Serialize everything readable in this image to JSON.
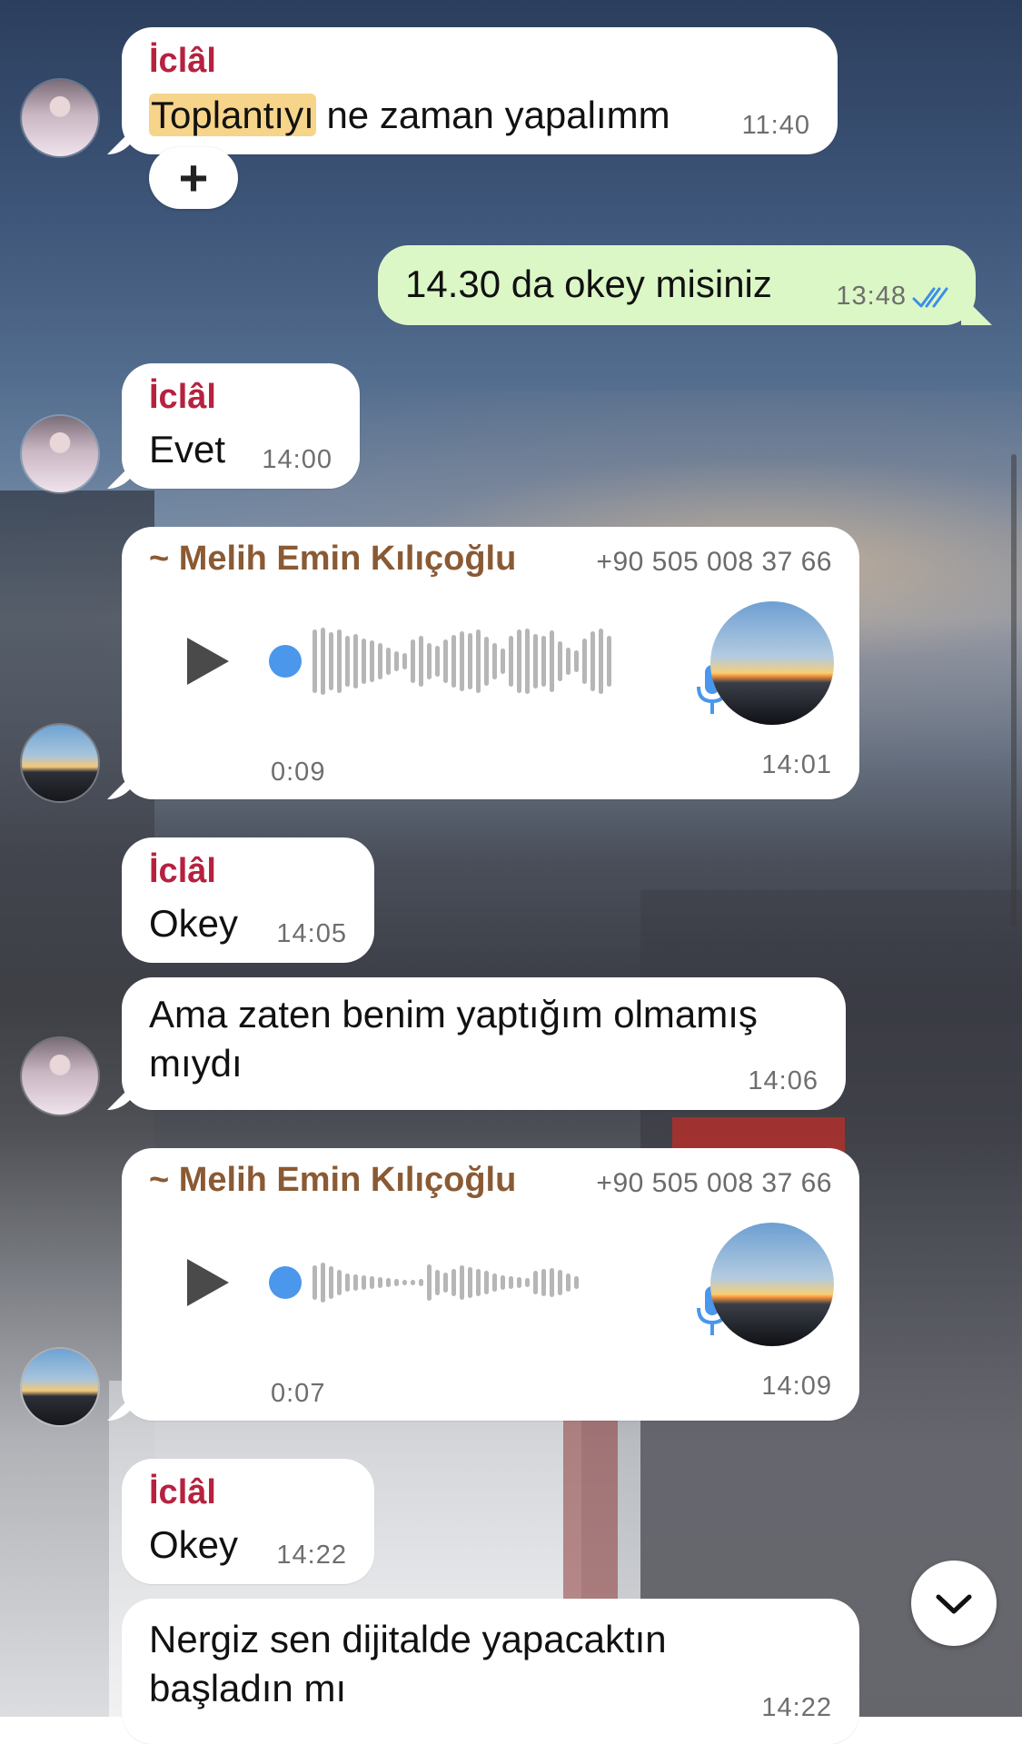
{
  "messages": [
    {
      "sender": "İclâl",
      "text_hl": "Toplantıyı",
      "text_rest": " ne zaman yapalımm",
      "time": "11:40"
    },
    {
      "text": "14.30 da okey misiniz",
      "time": "13:48"
    },
    {
      "sender": "İclâl",
      "text": "Evet",
      "time": "14:00"
    },
    {
      "sender": "~ Melih Emin Kılıçoğlu",
      "phone": "+90 505 008 37 66",
      "duration": "0:09",
      "time": "14:01"
    },
    {
      "sender": "İclâl",
      "text": "Okey",
      "time": "14:05"
    },
    {
      "text": "Ama zaten benim yaptığım olmamış mıydı",
      "time": "14:06"
    },
    {
      "sender": "~ Melih Emin Kılıçoğlu",
      "phone": "+90 505 008 37 66",
      "duration": "0:07",
      "time": "14:09"
    },
    {
      "sender": "İclâl",
      "text": "Okey",
      "time": "14:22"
    },
    {
      "text": "Nergiz sen dijitalde yapacaktın başladın mı",
      "time": "14:22"
    }
  ],
  "reaction_button": "+",
  "icons": {
    "read_receipt": "double-check-icon",
    "play": "play-icon",
    "mic": "microphone-icon",
    "scroll_down": "chevron-down-icon",
    "add_reaction": "plus-icon"
  },
  "colors": {
    "incoming_bubble": "#ffffff",
    "outgoing_bubble": "#dcf7c6",
    "sender_iclal": "#b5223f",
    "sender_melih": "#8a5a34",
    "highlight": "#f6d48a",
    "read_check": "#3a8fe8",
    "voice_progress": "#4a97ec"
  }
}
